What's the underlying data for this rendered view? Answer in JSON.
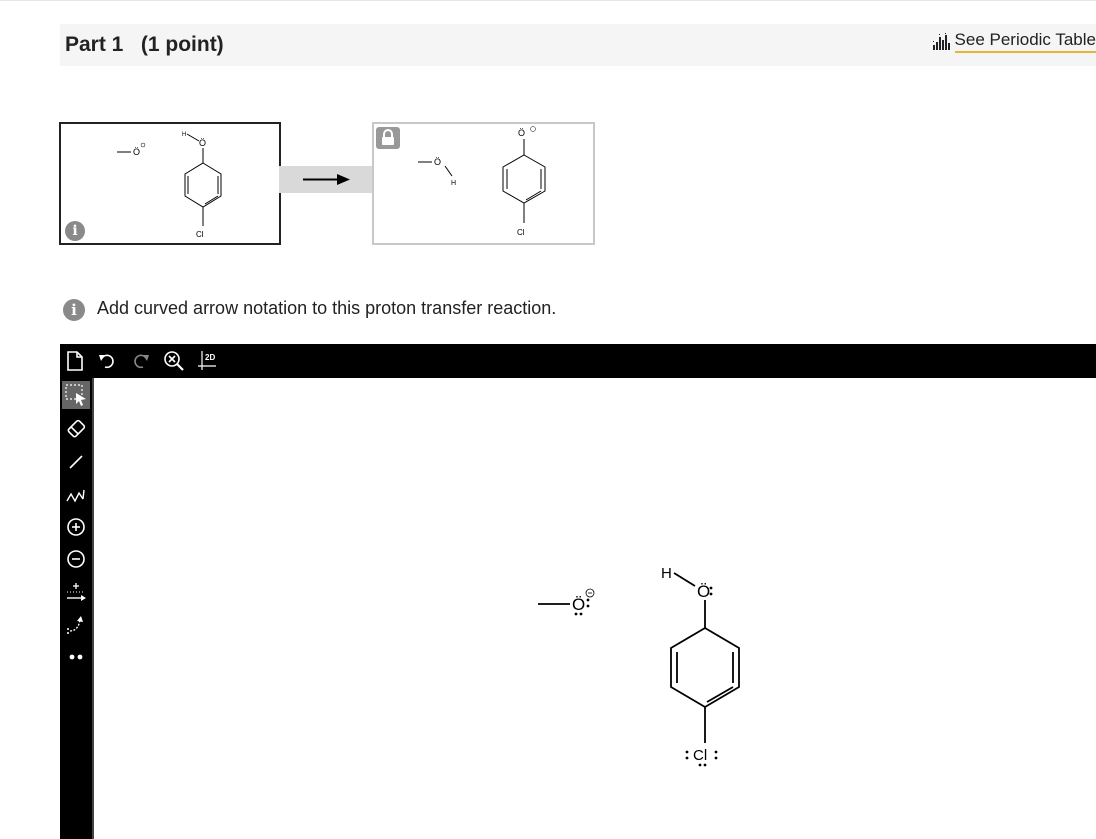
{
  "part": {
    "title": "Part 1   (1 point)"
  },
  "periodic_table": {
    "label": "See Periodic Table",
    "icon": "chart-bars-icon"
  },
  "reaction_preview": {
    "reactants": {
      "o_atom": "Ö",
      "h_atom": "H",
      "cl_atom": "Cl",
      "info_icon": "i"
    },
    "products": {
      "o_atom": "Ö",
      "h_atom": "H",
      "cl_atom": "Cl",
      "lock_icon": "lock-icon"
    }
  },
  "instruction": {
    "icon": "i",
    "text": "Add curved arrow notation to this proton transfer reaction."
  },
  "toolbar": {
    "items": [
      "new-document-icon",
      "undo-icon",
      "redo-icon",
      "zoom-reset-icon",
      "clean-2d-icon"
    ],
    "clean_label": "2D"
  },
  "sidebar": {
    "items": [
      "selection-tool-icon",
      "eraser-icon",
      "single-bond-icon",
      "chain-icon",
      "positive-charge-icon",
      "negative-charge-icon",
      "reaction-arrow-icon",
      "curved-arrow-icon",
      "electron-pair-icon"
    ],
    "selected": "selection-tool-icon"
  },
  "canvas": {
    "methoxide": {
      "o_atom": "Ö"
    },
    "phenol": {
      "h_atom": "H",
      "o_atom": "Ö",
      "cl_atom": "Cl"
    }
  }
}
